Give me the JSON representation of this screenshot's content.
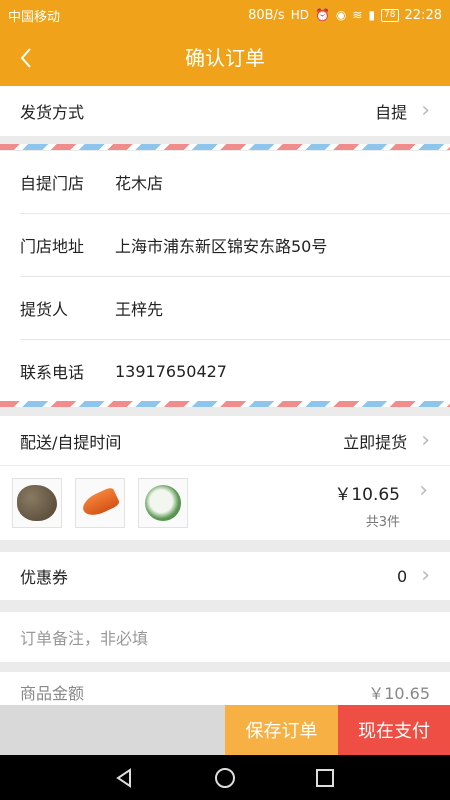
{
  "status_bar": {
    "carrier": "中国移动",
    "speed": "80B/s",
    "battery": "78",
    "time": "22:28"
  },
  "header": {
    "title": "确认订单"
  },
  "delivery_method": {
    "label": "发货方式",
    "value": "自提"
  },
  "store": {
    "items": [
      {
        "label": "自提门店",
        "value": "花木店"
      },
      {
        "label": "门店地址",
        "value": "上海市浦东新区锦安东路50号"
      },
      {
        "label": "提货人",
        "value": "王梓先"
      },
      {
        "label": "联系电话",
        "value": "13917650427"
      }
    ]
  },
  "delivery_time": {
    "label": "配送/自提时间",
    "value": "立即提货"
  },
  "goods": {
    "price": "￥10.65",
    "count": "共3件"
  },
  "coupon": {
    "label": "优惠券",
    "value": "0"
  },
  "note": {
    "placeholder": "订单备注，非必填"
  },
  "amount": {
    "label": "商品金额",
    "value": "￥10.65"
  },
  "actions": {
    "save_label": "保存订单",
    "pay_label": "现在支付"
  },
  "icons": [
    "back-icon",
    "chevron-right-icon",
    "alarm-icon",
    "eye-icon",
    "wifi-icon",
    "signal-icon",
    "battery-icon",
    "nav-back-icon",
    "nav-home-icon",
    "nav-recent-icon"
  ],
  "colors": {
    "primary": "#f0a31a",
    "save": "#f6b043",
    "pay": "#ee4e43"
  }
}
